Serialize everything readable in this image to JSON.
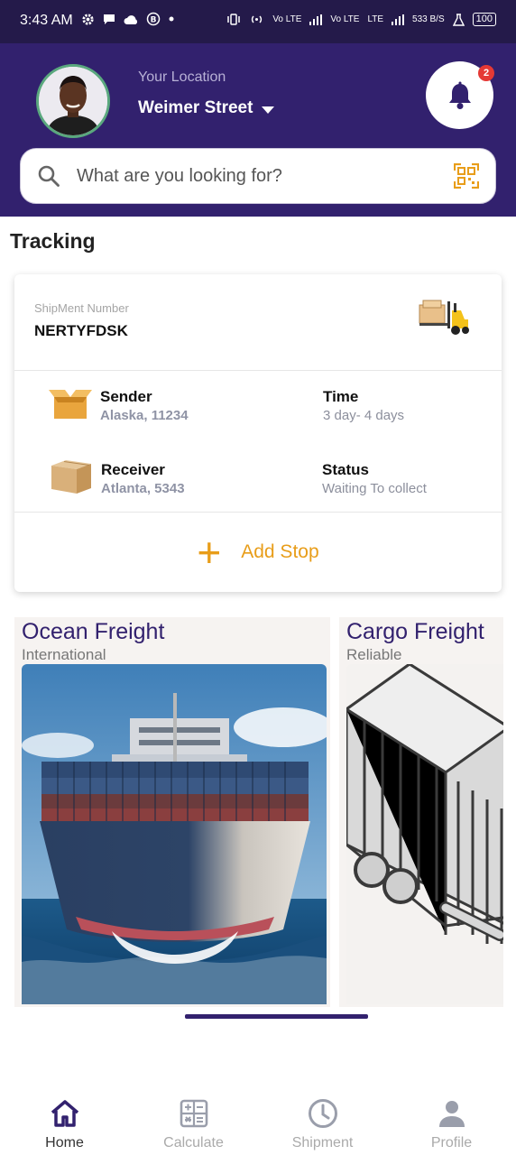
{
  "status_bar": {
    "time": "3:43 AM",
    "network_speed": "533 B/S",
    "battery": "100",
    "signal_labels": [
      "Vo LTE",
      "Vo LTE",
      "LTE"
    ]
  },
  "header": {
    "location_label": "Your Location",
    "location_value": "Weimer Street",
    "notification_count": "2",
    "search_placeholder": "What are you looking for?"
  },
  "tracking": {
    "title": "Tracking",
    "shipment_label": "ShipMent Number",
    "shipment_number": "NERTYFDSK",
    "sender_label": "Sender",
    "sender_value": "Alaska, 11234",
    "time_label": "Time",
    "time_value": "3 day- 4 days",
    "receiver_label": "Receiver",
    "receiver_value": "Atlanta, 5343",
    "status_label": "Status",
    "status_value": "Waiting To collect",
    "add_stop_label": "Add Stop"
  },
  "freight_cards": [
    {
      "title": "Ocean Freight",
      "subtitle": "International"
    },
    {
      "title": "Cargo Freight",
      "subtitle": "Reliable"
    }
  ],
  "bottom_nav": [
    {
      "label": "Home",
      "icon": "home-icon",
      "active": true
    },
    {
      "label": "Calculate",
      "icon": "calculator-icon",
      "active": false
    },
    {
      "label": "Shipment",
      "icon": "clock-icon",
      "active": false
    },
    {
      "label": "Profile",
      "icon": "person-icon",
      "active": false
    }
  ],
  "colors": {
    "primary": "#32216e",
    "accent": "#e89d19",
    "badge": "#e53935"
  }
}
